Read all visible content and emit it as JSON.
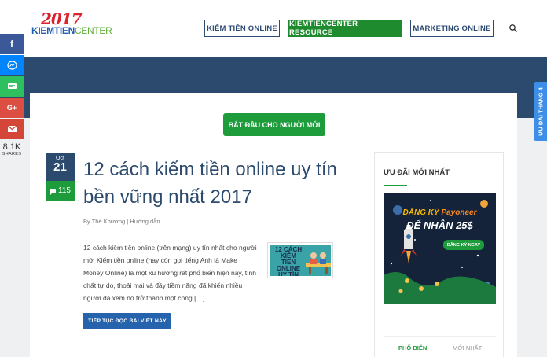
{
  "logo": {
    "year": "2017",
    "name_part1": "KIEMTIEN",
    "name_part2": "CENTER"
  },
  "nav": {
    "items": [
      {
        "label": "KIẾM TIỀN ONLINE"
      },
      {
        "label": "KIEMTIENCENTER RESOURCE"
      },
      {
        "label": "MARKETING ONLINE"
      }
    ]
  },
  "share": {
    "buttons": [
      {
        "label": "f",
        "color": "#3b5998"
      },
      {
        "label": "m",
        "color": "#0084ff"
      },
      {
        "label": "≡",
        "color": "#2ebf5f"
      },
      {
        "label": "G+",
        "color": "#dc4e41"
      },
      {
        "label": "M",
        "color": "#d44638"
      }
    ],
    "count": "8.1K",
    "label": "SHARES"
  },
  "side_tab": {
    "label": "ƯU ĐÃI THÁNG 4"
  },
  "main": {
    "start_button": "BẮT ĐẦU CHO NGƯỜI MỚI",
    "post": {
      "month": "Oct",
      "day": "21",
      "comments": "115",
      "title": "12 cách kiếm tiền online uy tín bền vững nhất 2017",
      "meta": "By Thế Khương | Hướng dẫn",
      "excerpt": "12 cách kiếm tiền online (trên mạng) uy tín nhất cho người mới Kiếm tiền online (hay còn gọi tiếng Anh là Make Money Online) là một xu hướng rất phổ biến hiện nay, tính chất tự do, thoải mái và đầy tiềm năng đã khiến nhiều người đã xem nó trở thành một công […]",
      "thumb_text": "12 CÁCH KIẾM TIỀN ONLINE UY TÍN",
      "read_more": "TIẾP TỤC ĐỌC BÀI VIẾT NÀY"
    }
  },
  "sidebar": {
    "title": "ƯU ĐÃI MỚI NHẤT",
    "ad": {
      "line1_prefix": "ĐĂNG KÝ",
      "brand": "Payoneer",
      "line2": "ĐỂ NHẬN 25$",
      "button": "ĐĂNG KÝ NGAY"
    },
    "tabs": [
      {
        "label": "PHỔ BIẾN"
      },
      {
        "label": "MỚI NHẤT"
      }
    ]
  },
  "colors": {
    "navy": "#2b4a6e",
    "green": "#1e9c3c",
    "blue_button": "#2563ad"
  }
}
